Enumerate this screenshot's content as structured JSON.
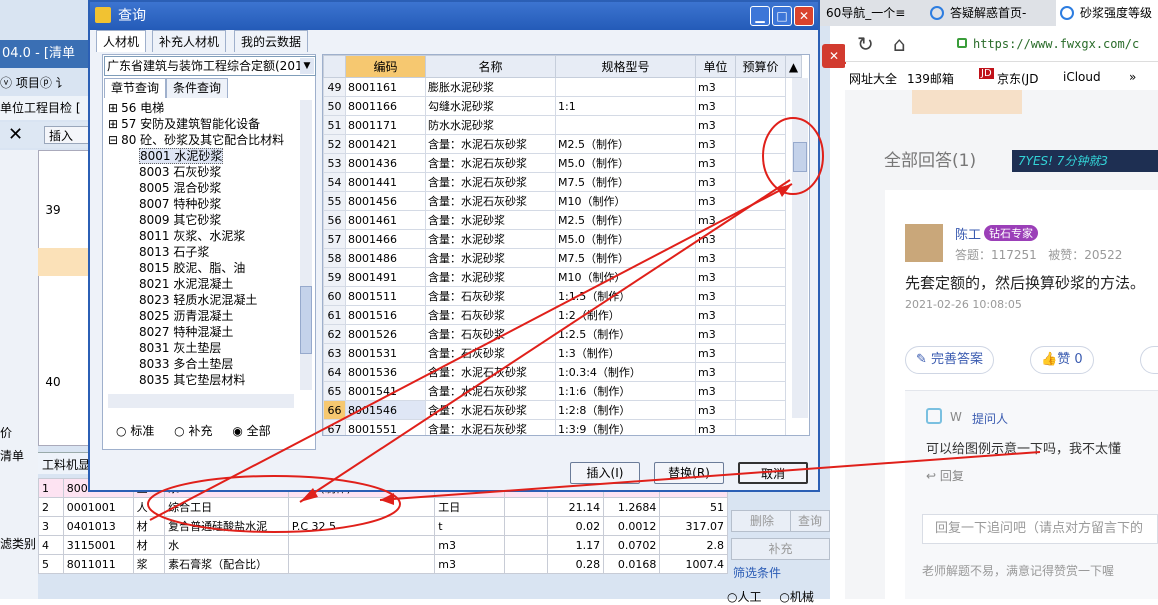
{
  "background_app": {
    "title": "04.0 - [清单",
    "menu": "ⓥ 项目ⓟ 讠",
    "strip": "单位工程目检 [",
    "close_glyph": "✕",
    "insert_label": "插入",
    "row_numbers": [
      "39",
      "40"
    ],
    "left_labels": [
      "价",
      "清单",
      "滤类别"
    ],
    "bottom_tab": "工料机显",
    "bottom_table": {
      "rows": [
        {
          "n": "1",
          "code": "8001546",
          "cat": "主",
          "name": "浆",
          "spec": "1:2:8(制作)",
          "unit": "m3",
          "a": "0",
          "b": "1.75",
          "c": "0.105",
          "d": "0"
        },
        {
          "n": "2",
          "code": "0001001",
          "cat": "人",
          "name": "综合工日",
          "spec": "",
          "unit": "工日",
          "a": "",
          "b": "21.14",
          "c": "1.2684",
          "d": "51"
        },
        {
          "n": "3",
          "code": "0401013",
          "cat": "材",
          "name": "复合普通硅酸盐水泥",
          "spec": "P.C 32.5",
          "unit": "t",
          "a": "",
          "b": "0.02",
          "c": "0.0012",
          "d": "317.07"
        },
        {
          "n": "4",
          "code": "3115001",
          "cat": "材",
          "name": "水",
          "spec": "",
          "unit": "m3",
          "a": "",
          "b": "1.17",
          "c": "0.0702",
          "d": "2.8"
        },
        {
          "n": "5",
          "code": "8011011",
          "cat": "浆",
          "name": "素石膏浆（配合比）",
          "spec": "",
          "unit": "m3",
          "a": "",
          "b": "0.28",
          "c": "0.0168",
          "d": "1007.4"
        }
      ]
    },
    "right_buttons": [
      "删除",
      "查询",
      "补充"
    ],
    "filter_label": "筛选条件",
    "filter_opts": [
      "人工",
      "机械"
    ]
  },
  "browser": {
    "tabs": [
      "60导航_一个≡",
      "答疑解惑首页-",
      "砂浆强度等级"
    ],
    "url": "https://www.fwxgx.com/c",
    "bookmarks": [
      "网址大全",
      "139邮箱",
      "京东(JD",
      "iCloud",
      "»"
    ],
    "all_answers": "全部回答(1)",
    "promo": "7YES! 7分钟就3",
    "answerer": "陈工",
    "badge": "钻石专家",
    "stats": "答题：117251   被赞：20522",
    "answer_text": "先套定额的，然后换算砂浆的方法。",
    "answer_time": "2021-02-26 10:08:05",
    "improve_btn": "完善答案",
    "like_btn": "赞 0",
    "questioner": "W",
    "questioner_tag": "提问人",
    "followup": "可以给图例示意一下吗，我不太懂",
    "reply": "回复",
    "reply_placeholder": "回复一下追问吧（请点对方留言下的",
    "footer_note": "老师解题不易，满意记得赞赏一下喔"
  },
  "dialog": {
    "title": "查询",
    "tabs": [
      "人材机",
      "补充人材机",
      "我的云数据"
    ],
    "library": "广东省建筑与装饰工程综合定额(201",
    "subtabs": [
      "章节查询",
      "条件查询"
    ],
    "tree": [
      {
        "exp": "⊞",
        "label": "56 电梯",
        "indent": 0
      },
      {
        "exp": "⊞",
        "label": "57 安防及建筑智能化设备",
        "indent": 0
      },
      {
        "exp": "⊟",
        "label": "80 砼、砂浆及其它配合比材料",
        "indent": 0
      },
      {
        "exp": "",
        "label": "8001 水泥砂浆",
        "indent": 1,
        "sel": true
      },
      {
        "exp": "",
        "label": "8003 石灰砂浆",
        "indent": 1
      },
      {
        "exp": "",
        "label": "8005 混合砂浆",
        "indent": 1
      },
      {
        "exp": "",
        "label": "8007 特种砂浆",
        "indent": 1
      },
      {
        "exp": "",
        "label": "8009 其它砂浆",
        "indent": 1
      },
      {
        "exp": "",
        "label": "8011 灰浆、水泥浆",
        "indent": 1
      },
      {
        "exp": "",
        "label": "8013 石子浆",
        "indent": 1
      },
      {
        "exp": "",
        "label": "8015 胶泥、脂、油",
        "indent": 1
      },
      {
        "exp": "",
        "label": "8021 水泥混凝土",
        "indent": 1
      },
      {
        "exp": "",
        "label": "8023 轻质水泥混凝土",
        "indent": 1
      },
      {
        "exp": "",
        "label": "8025 沥青混凝土",
        "indent": 1
      },
      {
        "exp": "",
        "label": "8027 特种混凝土",
        "indent": 1
      },
      {
        "exp": "",
        "label": "8031 灰土垫层",
        "indent": 1
      },
      {
        "exp": "",
        "label": "8033 多合土垫层",
        "indent": 1
      },
      {
        "exp": "",
        "label": "8035 其它垫层材料",
        "indent": 1
      }
    ],
    "radio_opts": [
      "标准",
      "补充",
      "全部"
    ],
    "columns": [
      "编码",
      "名称",
      "规格型号",
      "单位",
      "预算价"
    ],
    "rows": [
      {
        "n": "49",
        "code": "8001161",
        "name": "膨胀水泥砂浆",
        "spec": "",
        "unit": "m3"
      },
      {
        "n": "50",
        "code": "8001166",
        "name": "勾缝水泥砂浆",
        "spec": "1:1",
        "unit": "m3"
      },
      {
        "n": "51",
        "code": "8001171",
        "name": "防水水泥砂浆",
        "spec": "",
        "unit": "m3"
      },
      {
        "n": "52",
        "code": "8001421",
        "name": "含量：水泥石灰砂浆",
        "spec": "M2.5（制作）",
        "unit": "m3"
      },
      {
        "n": "53",
        "code": "8001436",
        "name": "含量：水泥石灰砂浆",
        "spec": "M5.0（制作）",
        "unit": "m3"
      },
      {
        "n": "54",
        "code": "8001441",
        "name": "含量：水泥石灰砂浆",
        "spec": "M7.5（制作）",
        "unit": "m3"
      },
      {
        "n": "55",
        "code": "8001456",
        "name": "含量：水泥石灰砂浆",
        "spec": "M10（制作）",
        "unit": "m3"
      },
      {
        "n": "56",
        "code": "8001461",
        "name": "含量：水泥砂浆",
        "spec": "M2.5（制作）",
        "unit": "m3"
      },
      {
        "n": "57",
        "code": "8001466",
        "name": "含量：水泥砂浆",
        "spec": "M5.0（制作）",
        "unit": "m3"
      },
      {
        "n": "58",
        "code": "8001486",
        "name": "含量：水泥砂浆",
        "spec": "M7.5（制作）",
        "unit": "m3"
      },
      {
        "n": "59",
        "code": "8001491",
        "name": "含量：水泥砂浆",
        "spec": "M10（制作）",
        "unit": "m3"
      },
      {
        "n": "60",
        "code": "8001511",
        "name": "含量：石灰砂浆",
        "spec": "1:1.5（制作）",
        "unit": "m3"
      },
      {
        "n": "61",
        "code": "8001516",
        "name": "含量：石灰砂浆",
        "spec": "1:2（制作）",
        "unit": "m3"
      },
      {
        "n": "62",
        "code": "8001526",
        "name": "含量：石灰砂浆",
        "spec": "1:2.5（制作）",
        "unit": "m3"
      },
      {
        "n": "63",
        "code": "8001531",
        "name": "含量：石灰砂浆",
        "spec": "1:3（制作）",
        "unit": "m3"
      },
      {
        "n": "64",
        "code": "8001536",
        "name": "含量：水泥石灰砂浆",
        "spec": "1:0.3:4（制作）",
        "unit": "m3"
      },
      {
        "n": "65",
        "code": "8001541",
        "name": "含量：水泥石灰砂浆",
        "spec": "1:1:6（制作）",
        "unit": "m3"
      },
      {
        "n": "66",
        "code": "8001546",
        "name": "含量：水泥石灰砂浆",
        "spec": "1:2:8（制作）",
        "unit": "m3",
        "sel": true
      },
      {
        "n": "67",
        "code": "8001551",
        "name": "含量：水泥石灰砂浆",
        "spec": "1:3:9（制作）",
        "unit": "m3"
      }
    ],
    "buttons": [
      "插入(I)",
      "替换(R)",
      "取消"
    ]
  },
  "colors": {
    "title_blue": "#2b5fb5",
    "annotation_red": "#e0201a",
    "selected_row": "#f6c870",
    "brand_purple": "#8e44ad"
  }
}
